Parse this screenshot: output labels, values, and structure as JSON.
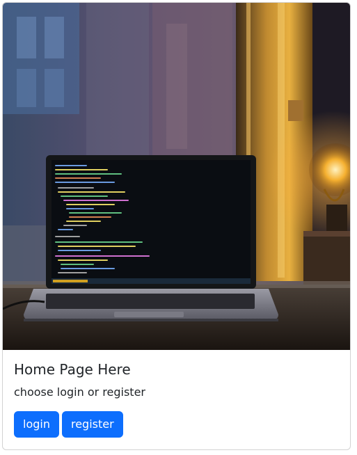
{
  "card": {
    "title": "Home Page Here",
    "text": "choose login or register",
    "image_icon": "laptop-at-window-photo"
  },
  "buttons": {
    "login_label": "login",
    "register_label": "register"
  },
  "colors": {
    "primary": "#0d6efd",
    "text": "#212529",
    "border": "rgba(0,0,0,0.175)"
  }
}
